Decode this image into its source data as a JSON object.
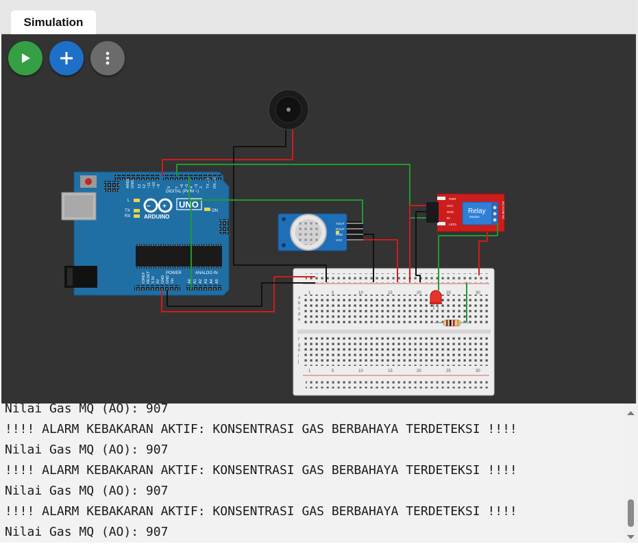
{
  "tabs": [
    {
      "label": "Simulation"
    }
  ],
  "toolbar": {
    "play_icon": "play-icon",
    "add_icon": "plus-icon",
    "more_icon": "more-vertical-icon",
    "colors": {
      "play": "#35a043",
      "add": "#1e6fc8",
      "more": "#6b6b6b"
    }
  },
  "circuit": {
    "arduino": {
      "brand": "ARDUINO",
      "model": "UNO",
      "digital_label": "DIGITAL (PWM ~)",
      "aref": "AREF",
      "gnd": "GND",
      "on_label": "ON",
      "l_label": "L",
      "tx_label": "TX",
      "rx_label": "RX",
      "power_label": "POWER",
      "analog_label": "ANALOG IN",
      "power_pins": [
        "IOREF",
        "RESET",
        "3.3V",
        "5V",
        "GND",
        "GND",
        "Vin"
      ],
      "analog_pins": [
        "A0",
        "A1",
        "A2",
        "A3",
        "A4",
        "A5"
      ],
      "digital_pins": [
        "13",
        "12",
        "~11",
        "~10",
        "~9",
        "8",
        "7",
        "~6",
        "~5",
        "4",
        "~3",
        "2",
        "TX→1",
        "RX←0"
      ]
    },
    "gas_sensor": {
      "pins": [
        "AOUT",
        "DOUT",
        "GND",
        "VCC"
      ]
    },
    "relay": {
      "title": "Relay",
      "subtitle": "Module",
      "pins": [
        "VCC",
        "GND",
        "IN"
      ],
      "leds": [
        "PWR",
        "LED1"
      ],
      "terminals": "NO COM NC"
    },
    "breadboard": {
      "col_labels": [
        "1",
        "5",
        "10",
        "15",
        "20",
        "25",
        "30"
      ],
      "row_labels_top": [
        "a",
        "b",
        "c",
        "d",
        "e"
      ],
      "row_labels_bottom": [
        "f",
        "g",
        "h",
        "i",
        "j"
      ]
    },
    "colors": {
      "board": "#1f6fa5",
      "wire_red": "#d01c1c",
      "wire_black": "#111111",
      "wire_green": "#1f9b2f",
      "relay_board": "#cc1d1d"
    }
  },
  "serial": {
    "lines": [
      "Nilai Gas MQ (AO): 907",
      "!!!! ALARM KEBAKARAN AKTIF: KONSENTRASI GAS BERBAHAYA TERDETEKSI !!!!",
      "Nilai Gas MQ (AO): 907",
      "!!!! ALARM KEBAKARAN AKTIF: KONSENTRASI GAS BERBAHAYA TERDETEKSI !!!!",
      "Nilai Gas MQ (AO): 907",
      "!!!! ALARM KEBAKARAN AKTIF: KONSENTRASI GAS BERBAHAYA TERDETEKSI !!!!",
      "Nilai Gas MQ (AO): 907"
    ]
  }
}
